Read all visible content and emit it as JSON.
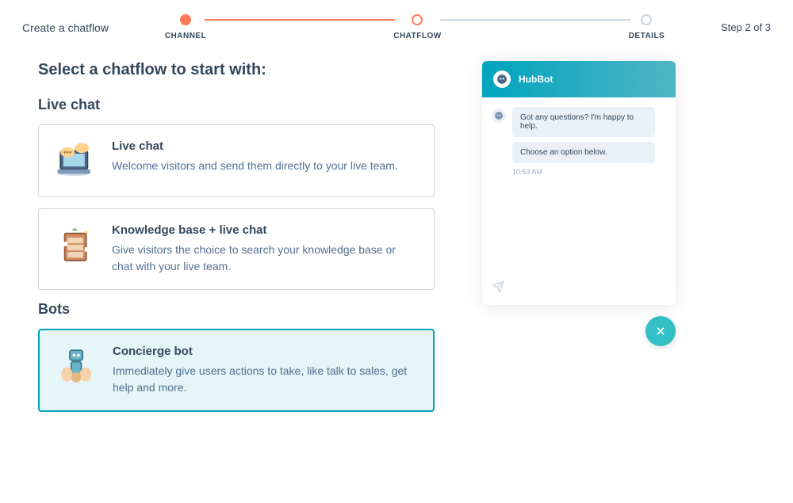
{
  "header": {
    "breadcrumb": "Create a chatflow",
    "step_indicator": "Step 2 of 3"
  },
  "stepper": {
    "steps": [
      {
        "label": "CHANNEL",
        "state": "done"
      },
      {
        "label": "CHATFLOW",
        "state": "active"
      },
      {
        "label": "DETAILS",
        "state": ""
      }
    ]
  },
  "page": {
    "title": "Select a chatflow to start with:"
  },
  "sections": {
    "live_chat": {
      "title": "Live chat",
      "options": [
        {
          "title": "Live chat",
          "desc": "Welcome visitors and send them directly to your live team.",
          "selected": false
        },
        {
          "title": "Knowledge base + live chat",
          "desc": "Give visitors the choice to search your knowledge base or chat with your live team.",
          "selected": false
        }
      ]
    },
    "bots": {
      "title": "Bots",
      "options": [
        {
          "title": "Concierge bot",
          "desc": "Immediately give users actions to take, like talk to sales, get help and more.",
          "selected": true
        }
      ]
    }
  },
  "chat_preview": {
    "bot_name": "HubBot",
    "messages": [
      "Got any questions? I'm happy to help.",
      "Choose an option below."
    ],
    "timestamp": "10:53 AM"
  }
}
